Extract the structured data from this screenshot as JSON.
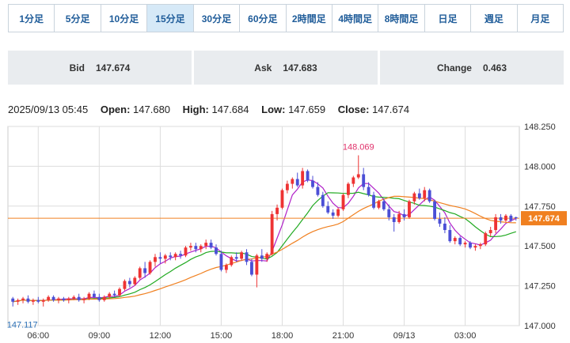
{
  "timeframes": [
    {
      "label": "1分足",
      "active": false
    },
    {
      "label": "5分足",
      "active": false
    },
    {
      "label": "10分足",
      "active": false
    },
    {
      "label": "15分足",
      "active": true
    },
    {
      "label": "30分足",
      "active": false
    },
    {
      "label": "60分足",
      "active": false
    },
    {
      "label": "2時間足",
      "active": false
    },
    {
      "label": "4時間足",
      "active": false
    },
    {
      "label": "8時間足",
      "active": false
    },
    {
      "label": "日足",
      "active": false
    },
    {
      "label": "週足",
      "active": false
    },
    {
      "label": "月足",
      "active": false
    }
  ],
  "quotes": {
    "bid_label": "Bid",
    "bid_value": "147.674",
    "ask_label": "Ask",
    "ask_value": "147.683",
    "change_label": "Change",
    "change_value": "0.463"
  },
  "ohlc": {
    "datetime": "2025/09/13 05:45",
    "open_label": "Open:",
    "open": "147.680",
    "high_label": "High:",
    "high": "147.684",
    "low_label": "Low:",
    "low": "147.659",
    "close_label": "Close:",
    "close": "147.674"
  },
  "colors": {
    "up": "#ee3333",
    "down": "#4b4fd6",
    "ma_short": "#b020c8",
    "ma_mid": "#22aa22",
    "ma_long": "#f08020",
    "current_line": "#f08020",
    "grid": "#dddddd",
    "high_label": "#e0306a",
    "low_label": "#2b6fb5"
  },
  "chart_data": {
    "type": "candlestick",
    "ylim": [
      147.0,
      148.25
    ],
    "y_ticks": [
      "148.250",
      "148.000",
      "147.750",
      "147.500",
      "147.250",
      "147.000"
    ],
    "x_ticks": [
      "06:00",
      "09:00",
      "12:00",
      "15:00",
      "18:00",
      "21:00",
      "09/13",
      "03:00"
    ],
    "current_price_label": "147.674",
    "current_price": 147.674,
    "high_annotation": "148.069",
    "high_value": 148.069,
    "low_annotation": "147.117",
    "low_value": 147.117,
    "candles": [
      [
        147.17,
        147.18,
        147.12,
        147.15
      ],
      [
        147.15,
        147.17,
        147.13,
        147.16
      ],
      [
        147.16,
        147.18,
        147.14,
        147.17
      ],
      [
        147.17,
        147.19,
        147.14,
        147.15
      ],
      [
        147.15,
        147.17,
        147.13,
        147.16
      ],
      [
        147.16,
        147.18,
        147.14,
        147.15
      ],
      [
        147.15,
        147.17,
        147.12,
        147.16
      ],
      [
        147.16,
        147.19,
        147.15,
        147.18
      ],
      [
        147.18,
        147.19,
        147.15,
        147.16
      ],
      [
        147.16,
        147.18,
        147.14,
        147.17
      ],
      [
        147.17,
        147.18,
        147.15,
        147.16
      ],
      [
        147.16,
        147.18,
        147.14,
        147.17
      ],
      [
        147.17,
        147.19,
        147.16,
        147.18
      ],
      [
        147.18,
        147.2,
        147.15,
        147.16
      ],
      [
        147.16,
        147.18,
        147.14,
        147.17
      ],
      [
        147.17,
        147.21,
        147.16,
        147.2
      ],
      [
        147.2,
        147.22,
        147.17,
        147.18
      ],
      [
        147.18,
        147.2,
        147.15,
        147.16
      ],
      [
        147.16,
        147.19,
        147.15,
        147.18
      ],
      [
        147.18,
        147.21,
        147.17,
        147.2
      ],
      [
        147.2,
        147.22,
        147.18,
        147.19
      ],
      [
        147.19,
        147.24,
        147.18,
        147.23
      ],
      [
        147.23,
        147.29,
        147.22,
        147.28
      ],
      [
        147.28,
        147.3,
        147.24,
        147.26
      ],
      [
        147.26,
        147.31,
        147.25,
        147.3
      ],
      [
        147.3,
        147.37,
        147.29,
        147.36
      ],
      [
        147.36,
        147.4,
        147.3,
        147.33
      ],
      [
        147.33,
        147.41,
        147.32,
        147.4
      ],
      [
        147.4,
        147.45,
        147.37,
        147.43
      ],
      [
        147.43,
        147.46,
        147.39,
        147.42
      ],
      [
        147.42,
        147.45,
        147.39,
        147.44
      ],
      [
        147.44,
        147.46,
        147.41,
        147.43
      ],
      [
        147.43,
        147.46,
        147.41,
        147.45
      ],
      [
        147.45,
        147.47,
        147.42,
        147.44
      ],
      [
        147.44,
        147.5,
        147.43,
        147.49
      ],
      [
        147.49,
        147.52,
        147.47,
        147.5
      ],
      [
        147.5,
        147.52,
        147.46,
        147.48
      ],
      [
        147.48,
        147.51,
        147.46,
        147.5
      ],
      [
        147.5,
        147.54,
        147.48,
        147.52
      ],
      [
        147.52,
        147.54,
        147.48,
        147.49
      ],
      [
        147.49,
        147.51,
        147.44,
        147.45
      ],
      [
        147.45,
        147.47,
        147.34,
        147.35
      ],
      [
        147.35,
        147.39,
        147.33,
        147.38
      ],
      [
        147.38,
        147.44,
        147.37,
        147.43
      ],
      [
        147.43,
        147.46,
        147.4,
        147.42
      ],
      [
        147.42,
        147.47,
        147.41,
        147.46
      ],
      [
        147.46,
        147.48,
        147.38,
        147.4
      ],
      [
        147.4,
        147.42,
        147.31,
        147.32
      ],
      [
        147.32,
        147.45,
        147.24,
        147.44
      ],
      [
        147.44,
        147.48,
        147.4,
        147.42
      ],
      [
        147.42,
        147.46,
        147.4,
        147.45
      ],
      [
        147.45,
        147.72,
        147.44,
        147.7
      ],
      [
        147.7,
        147.76,
        147.66,
        147.74
      ],
      [
        147.74,
        147.86,
        147.73,
        147.85
      ],
      [
        147.85,
        147.91,
        147.83,
        147.89
      ],
      [
        147.89,
        147.93,
        147.86,
        147.92
      ],
      [
        147.92,
        147.96,
        147.87,
        147.88
      ],
      [
        147.88,
        147.99,
        147.86,
        147.97
      ],
      [
        147.97,
        147.98,
        147.9,
        147.91
      ],
      [
        147.91,
        147.94,
        147.86,
        147.87
      ],
      [
        147.87,
        147.9,
        147.81,
        147.82
      ],
      [
        147.82,
        147.84,
        147.74,
        147.75
      ],
      [
        147.75,
        147.78,
        147.7,
        147.71
      ],
      [
        147.71,
        147.73,
        147.67,
        147.69
      ],
      [
        147.69,
        147.74,
        147.68,
        147.73
      ],
      [
        147.73,
        147.83,
        147.72,
        147.82
      ],
      [
        147.82,
        147.9,
        147.8,
        147.89
      ],
      [
        147.89,
        147.94,
        147.87,
        147.93
      ],
      [
        147.93,
        148.069,
        147.92,
        147.95
      ],
      [
        147.95,
        147.99,
        147.85,
        147.87
      ],
      [
        147.87,
        147.9,
        147.81,
        147.82
      ],
      [
        147.82,
        147.84,
        147.73,
        147.74
      ],
      [
        147.74,
        147.79,
        147.73,
        147.78
      ],
      [
        147.78,
        147.8,
        147.72,
        147.73
      ],
      [
        147.73,
        147.76,
        147.66,
        147.68
      ],
      [
        147.68,
        147.7,
        147.59,
        147.65
      ],
      [
        147.65,
        147.72,
        147.64,
        147.7
      ],
      [
        147.7,
        147.73,
        147.66,
        147.68
      ],
      [
        147.68,
        147.79,
        147.67,
        147.78
      ],
      [
        147.78,
        147.84,
        147.76,
        147.83
      ],
      [
        147.83,
        147.86,
        147.79,
        147.8
      ],
      [
        147.8,
        147.87,
        147.78,
        147.85
      ],
      [
        147.85,
        147.86,
        147.77,
        147.78
      ],
      [
        147.78,
        147.79,
        147.66,
        147.67
      ],
      [
        147.67,
        147.71,
        147.62,
        147.64
      ],
      [
        147.64,
        147.68,
        147.58,
        147.6
      ],
      [
        147.6,
        147.63,
        147.52,
        147.53
      ],
      [
        147.53,
        147.56,
        147.51,
        147.55
      ],
      [
        147.55,
        147.56,
        147.5,
        147.51
      ],
      [
        147.51,
        147.53,
        147.49,
        147.52
      ],
      [
        147.52,
        147.53,
        147.48,
        147.49
      ],
      [
        147.49,
        147.51,
        147.47,
        147.5
      ],
      [
        147.5,
        147.52,
        147.48,
        147.51
      ],
      [
        147.51,
        147.59,
        147.5,
        147.58
      ],
      [
        147.58,
        147.62,
        147.56,
        147.6
      ],
      [
        147.6,
        147.7,
        147.58,
        147.68
      ],
      [
        147.68,
        147.7,
        147.64,
        147.66
      ],
      [
        147.66,
        147.7,
        147.65,
        147.69
      ],
      [
        147.69,
        147.7,
        147.65,
        147.66
      ],
      [
        147.68,
        147.684,
        147.659,
        147.674
      ]
    ]
  }
}
